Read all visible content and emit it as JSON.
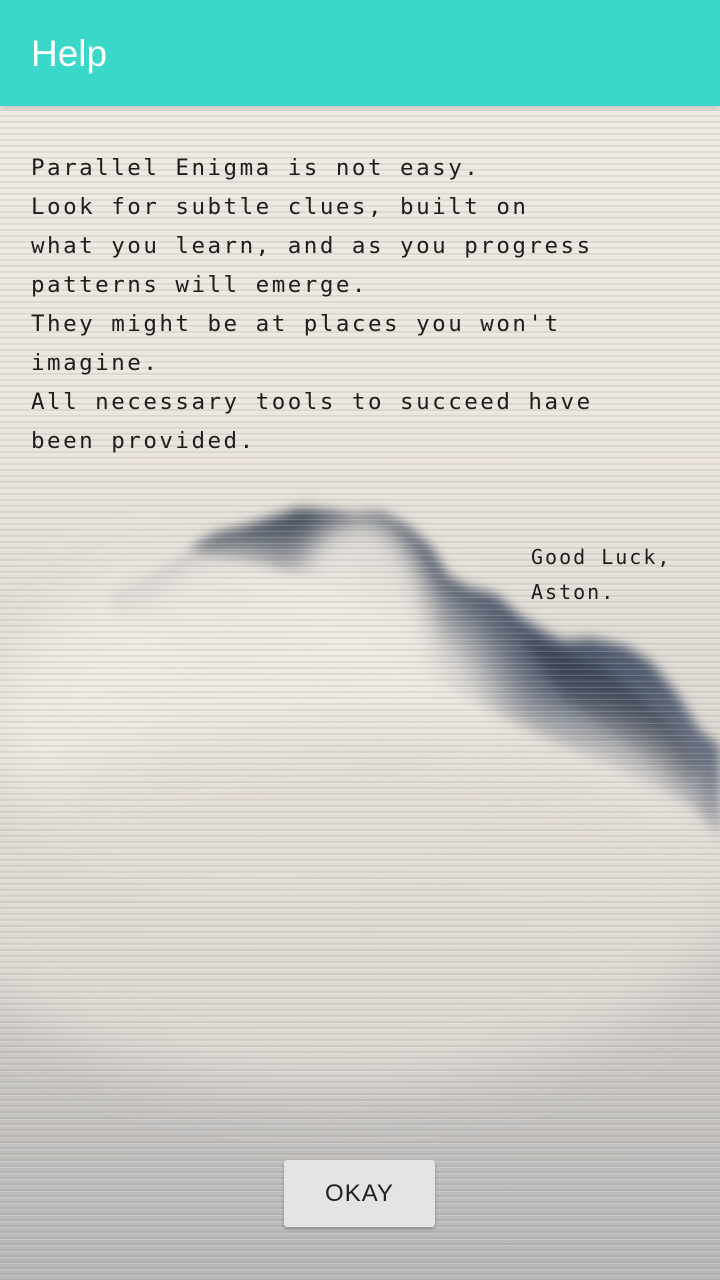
{
  "app_bar": {
    "title": "Help",
    "color": "#3ad8c8"
  },
  "help": {
    "lines": [
      "Parallel Enigma is not easy.",
      "Look for subtle clues, built on",
      "what you learn, and as you progress",
      "patterns will emerge.",
      "They might be at places you won't",
      "imagine.",
      "All necessary tools to succeed have",
      "been provided."
    ]
  },
  "signoff": {
    "line1": "Good Luck,",
    "line2": "Aston."
  },
  "background": {
    "image": "misty-mountain-peak"
  },
  "actions": {
    "okay_label": "OKAY"
  }
}
